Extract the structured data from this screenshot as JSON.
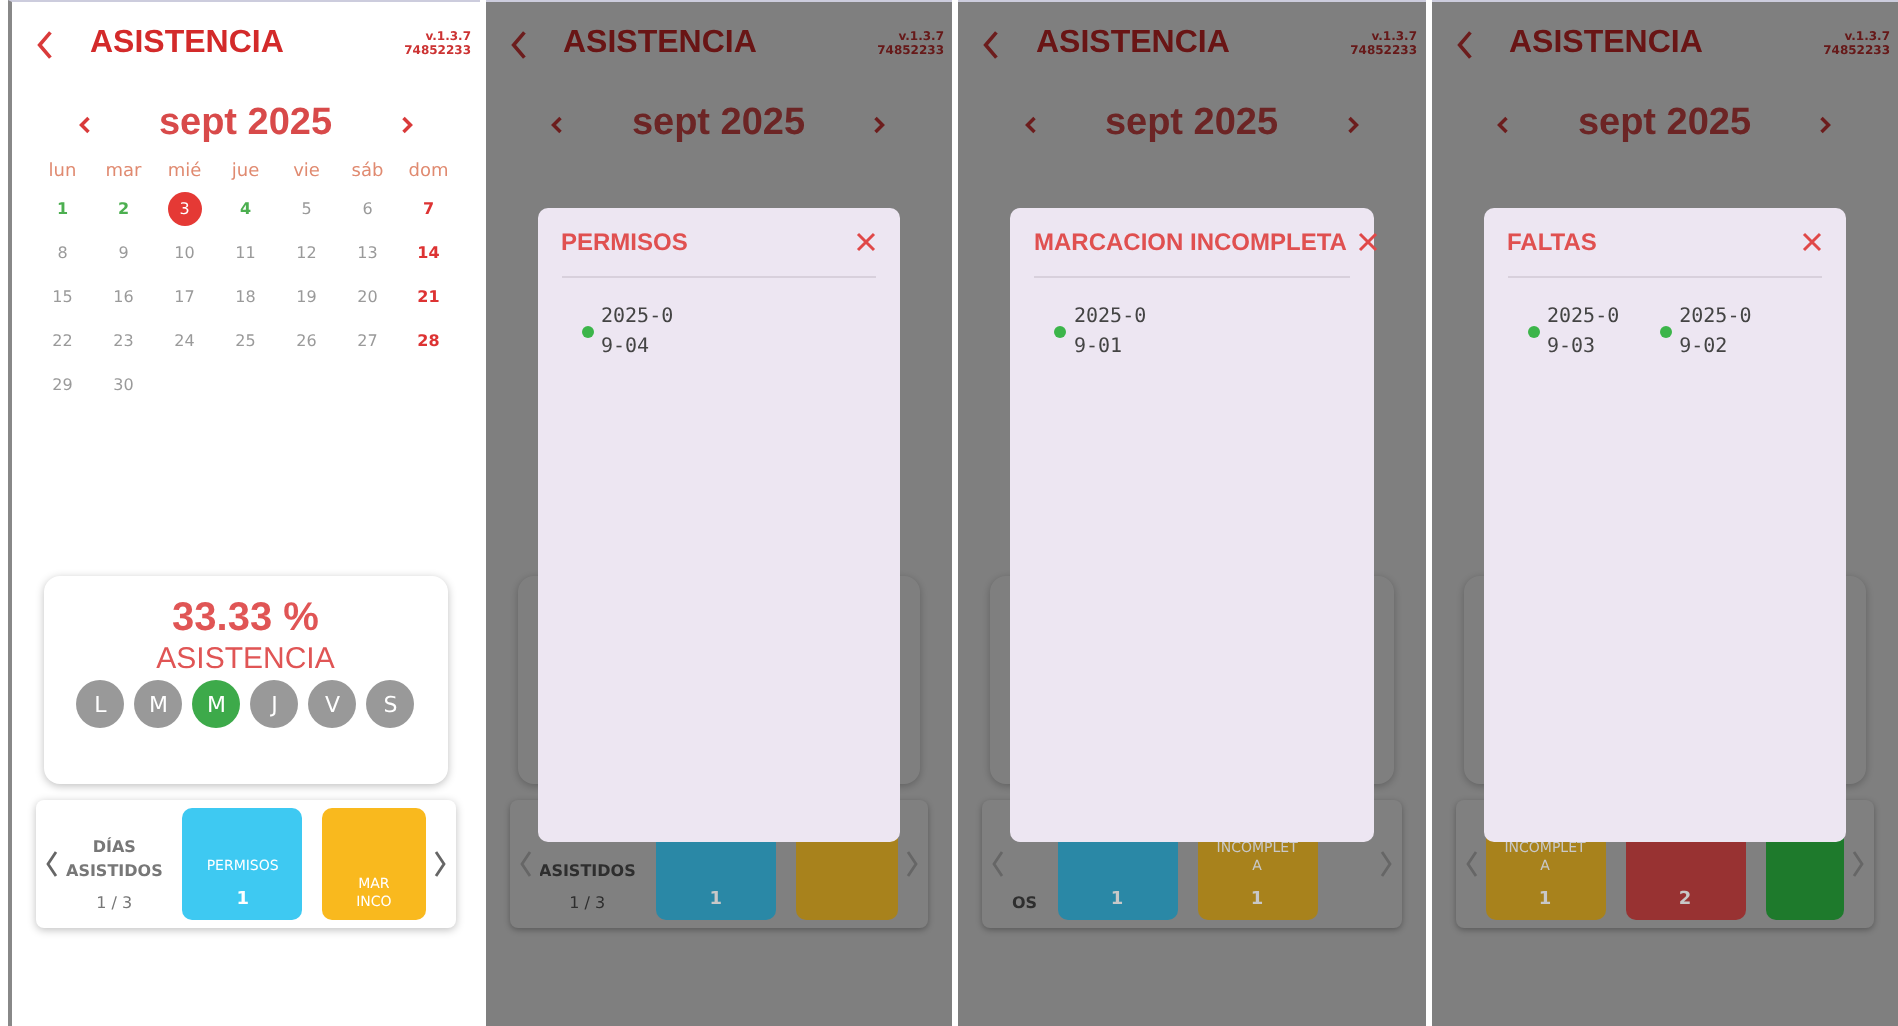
{
  "screens": [
    {
      "header": {
        "title": "ASISTENCIA",
        "version": "v.1.3.7",
        "code": "74852233"
      },
      "month": "sept 2025",
      "calendar": {
        "weekdays": [
          "lun",
          "mar",
          "mié",
          "jue",
          "vie",
          "sáb",
          "dom"
        ],
        "days": [
          {
            "day": "1",
            "kind": "present",
            "selected": false
          },
          {
            "day": "2",
            "kind": "present",
            "selected": false
          },
          {
            "day": "3",
            "kind": "normal",
            "selected": true
          },
          {
            "day": "4",
            "kind": "present",
            "selected": false
          },
          {
            "day": "5",
            "kind": "normal",
            "selected": false
          },
          {
            "day": "6",
            "kind": "normal",
            "selected": false
          },
          {
            "day": "7",
            "kind": "sunday",
            "selected": false
          },
          {
            "day": "8",
            "kind": "normal",
            "selected": false
          },
          {
            "day": "9",
            "kind": "normal",
            "selected": false
          },
          {
            "day": "10",
            "kind": "normal",
            "selected": false
          },
          {
            "day": "11",
            "kind": "normal",
            "selected": false
          },
          {
            "day": "12",
            "kind": "normal",
            "selected": false
          },
          {
            "day": "13",
            "kind": "normal",
            "selected": false
          },
          {
            "day": "14",
            "kind": "sunday",
            "selected": false
          },
          {
            "day": "15",
            "kind": "normal",
            "selected": false
          },
          {
            "day": "16",
            "kind": "normal",
            "selected": false
          },
          {
            "day": "17",
            "kind": "normal",
            "selected": false
          },
          {
            "day": "18",
            "kind": "normal",
            "selected": false
          },
          {
            "day": "19",
            "kind": "normal",
            "selected": false
          },
          {
            "day": "20",
            "kind": "normal",
            "selected": false
          },
          {
            "day": "21",
            "kind": "sunday",
            "selected": false
          },
          {
            "day": "22",
            "kind": "normal",
            "selected": false
          },
          {
            "day": "23",
            "kind": "normal",
            "selected": false
          },
          {
            "day": "24",
            "kind": "normal",
            "selected": false
          },
          {
            "day": "25",
            "kind": "normal",
            "selected": false
          },
          {
            "day": "26",
            "kind": "normal",
            "selected": false
          },
          {
            "day": "27",
            "kind": "normal",
            "selected": false
          },
          {
            "day": "28",
            "kind": "sunday",
            "selected": false
          },
          {
            "day": "29",
            "kind": "normal",
            "selected": false
          },
          {
            "day": "30",
            "kind": "normal",
            "selected": false
          }
        ]
      },
      "summary": {
        "percent": "33.33 %",
        "label": "ASISTENCIA",
        "days": [
          {
            "letter": "L",
            "selected": false
          },
          {
            "letter": "M",
            "selected": false
          },
          {
            "letter": "M",
            "selected": true
          },
          {
            "letter": "J",
            "selected": false
          },
          {
            "letter": "V",
            "selected": false
          },
          {
            "letter": "S",
            "selected": false
          }
        ]
      },
      "carousel": [
        {
          "kind": "text",
          "lines": [
            "DÍAS",
            "ASISTIDOS"
          ],
          "value": "1 / 3"
        },
        {
          "kind": "tile",
          "color": "#3ec9f2",
          "lines": [
            "PERMISOS"
          ],
          "value": "1"
        },
        {
          "kind": "tile",
          "color": "#f9b91e",
          "lines": [
            "MAR",
            "INCO"
          ]
        }
      ]
    },
    {
      "header": {
        "title": "ASISTENCIA",
        "version": "v.1.3.7",
        "code": "74852233"
      },
      "month": "sept 2025",
      "carousel": [
        {
          "kind": "text",
          "lines": [
            "ASISTIDOS"
          ],
          "value": "1 / 3"
        },
        {
          "kind": "tile",
          "color": "#2a88a6",
          "value": "1"
        },
        {
          "kind": "tile",
          "color": "#a8821c"
        }
      ],
      "modal": {
        "title": "PERMISOS",
        "items": [
          "2025-09-04"
        ]
      }
    },
    {
      "header": {
        "title": "ASISTENCIA",
        "version": "v.1.3.7",
        "code": "74852233"
      },
      "month": "sept 2025",
      "carousel": [
        {
          "kind": "text",
          "lines": [
            "OS"
          ]
        },
        {
          "kind": "tile",
          "color": "#2a88a6",
          "value": "1"
        },
        {
          "kind": "tile",
          "color": "#a8821c",
          "lines": [
            "INCOMPLET",
            "A"
          ],
          "value": "1"
        }
      ],
      "modal": {
        "title": "MARCACION INCOMPLETA",
        "items": [
          "2025-09-01"
        ]
      }
    },
    {
      "header": {
        "title": "ASISTENCIA",
        "version": "v.1.3.7",
        "code": "74852233"
      },
      "month": "sept 2025",
      "carousel": [
        {
          "kind": "tile",
          "color": "#a8821c",
          "lines": [
            "INCOMPLET",
            "A"
          ],
          "value": "1"
        },
        {
          "kind": "tile",
          "color": "#983232",
          "value": "2"
        },
        {
          "kind": "tile",
          "color": "#1e7a2c"
        }
      ],
      "modal": {
        "title": "FALTAS",
        "items": [
          "2025-09-03",
          "2025-09-02"
        ]
      }
    }
  ]
}
